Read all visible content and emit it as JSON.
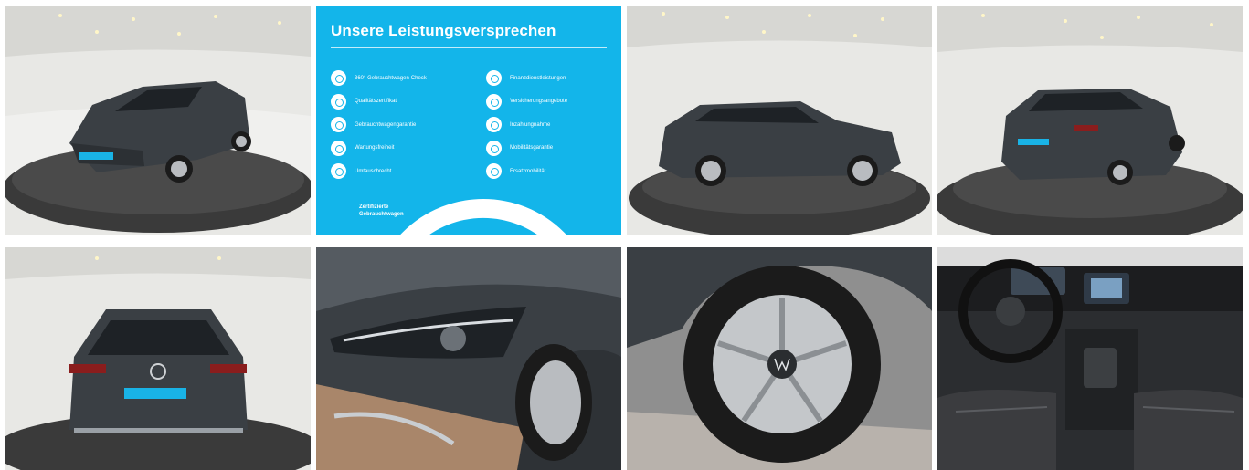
{
  "gallery": {
    "tiles": [
      {
        "label": "Exterior front three-quarter view on turntable"
      },
      {
        "label": "Leistungsversprechen overview"
      },
      {
        "label": "Exterior side view"
      },
      {
        "label": "Exterior rear three-quarter view"
      },
      {
        "label": "Exterior rear view"
      },
      {
        "label": "Headlight detail"
      },
      {
        "label": "Alloy wheel detail"
      },
      {
        "label": "Interior cockpit"
      }
    ]
  },
  "promo": {
    "title": "Unsere Leistungsversprechen",
    "left_items": [
      "360° Gebrauchtwagen-Check",
      "Qualitätszertifikat",
      "Gebrauchtwagengarantie",
      "Wartungsfreiheit",
      "Umtauschrecht"
    ],
    "right_items": [
      "Finanzdienstleistungen",
      "Versicherungsangebote",
      "Inzahlungnahme",
      "Mobilitätsgarantie",
      "Ersatzmobilität"
    ],
    "logo_line1": "Zertifizierte",
    "logo_line2": "Gebrauchtwagen"
  },
  "colors": {
    "promo_bg": "#13b5ea",
    "car_body": "#3a3f44",
    "turntable": "#3b3b3b",
    "showroom_wall": "#e6e6e3",
    "plate_badge": "#19b3e6"
  }
}
